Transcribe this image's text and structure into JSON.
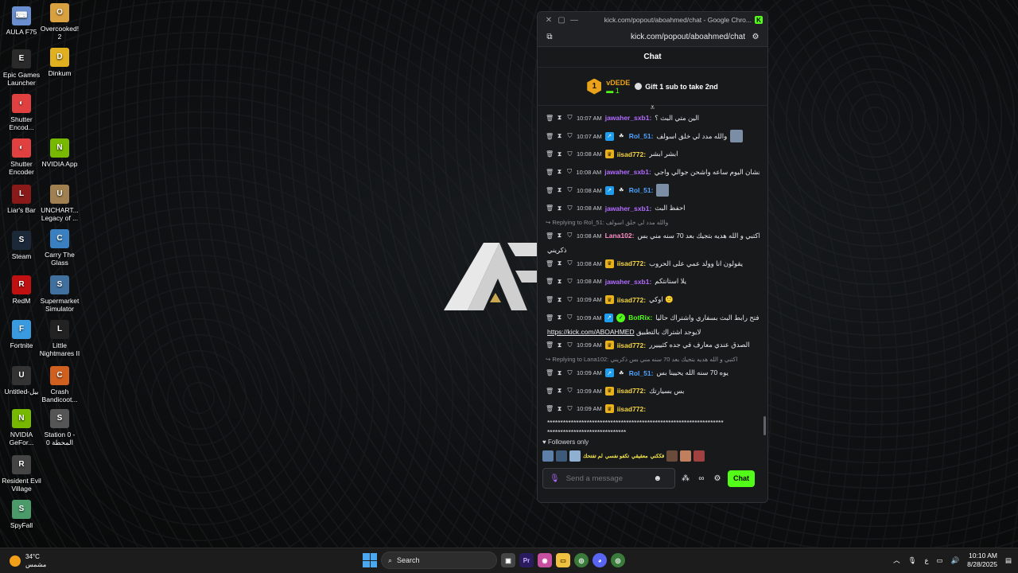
{
  "desktop": {
    "icons": [
      {
        "label": "AULA F75",
        "color": "#6a8fd0",
        "glyph": "⌨"
      },
      {
        "label": "Overcooked! 2",
        "color": "#d9a040",
        "glyph": "O"
      },
      {
        "label": "Epic Games Launcher",
        "color": "#2a2a2a",
        "glyph": "E"
      },
      {
        "label": "Dinkum",
        "color": "#e0b020",
        "glyph": "D"
      },
      {
        "label": "Shutter Encod...",
        "color": "#e04040",
        "glyph": "◐"
      },
      {
        "label": "Shutter Encoder",
        "color": "#e04040",
        "glyph": "◐"
      },
      {
        "label": "NVIDIA App",
        "color": "#76b900",
        "glyph": "N"
      },
      {
        "label": "Liar's Bar",
        "color": "#8a1a1a",
        "glyph": "L"
      },
      {
        "label": "UNCHART... Legacy of ...",
        "color": "#a08050",
        "glyph": "U"
      },
      {
        "label": "Steam",
        "color": "#1b2838",
        "glyph": "S"
      },
      {
        "label": "Carry The Glass",
        "color": "#3a80c0",
        "glyph": "C"
      },
      {
        "label": "RedM",
        "color": "#c01010",
        "glyph": "R"
      },
      {
        "label": "Supermarket Simulator",
        "color": "#4070a0",
        "glyph": "S"
      },
      {
        "label": "Fortnite",
        "color": "#3a9ae0",
        "glyph": "F"
      },
      {
        "label": "Little Nightmares II",
        "color": "#222",
        "glyph": "L"
      },
      {
        "label": "Untitled-بيل",
        "color": "#333",
        "glyph": "U"
      },
      {
        "label": "Crash Bandicoot...",
        "color": "#d06020",
        "glyph": "C"
      },
      {
        "label": "NVIDIA GeFor...",
        "color": "#76b900",
        "glyph": "N"
      },
      {
        "label": "Station 0 - المحطة 0",
        "color": "#555",
        "glyph": "S"
      },
      {
        "label": "Resident Evil Village",
        "color": "#444",
        "glyph": "R"
      },
      {
        "label": "SpyFall",
        "color": "#4a9a6a",
        "glyph": "S"
      }
    ]
  },
  "window": {
    "title": "kick.com/popout/aboahmed/chat - Google Chro...",
    "url": "kick.com/popout/aboahmed/chat"
  },
  "chat": {
    "header": "Chat",
    "pinned": {
      "rank": "1",
      "gifter": "vDEDE",
      "count": "1",
      "gift_text": "Gift 1 sub to take 2nd"
    },
    "messages": [
      {
        "time": "10:07 AM",
        "user": "jawaher_sxb1:",
        "color": "#b36bff",
        "badges": [],
        "text": "الين متي البث ؟"
      },
      {
        "time": "10:07 AM",
        "user": "Rol_51:",
        "color": "#4fa3ff",
        "badges": [
          "og",
          "sub"
        ],
        "text": "والله مدد لي خلق اسولف",
        "avatar": true
      },
      {
        "time": "10:08 AM",
        "user": "iisad772:",
        "color": "#f5d742",
        "badges": [
          "crown"
        ],
        "text": "ابشر ابشر"
      },
      {
        "time": "10:08 AM",
        "user": "jawaher_sxb1:",
        "color": "#b36bff",
        "badges": [],
        "text": "عشان اليوم ساعه واشحن جوالي واجي"
      },
      {
        "time": "10:08 AM",
        "user": "Rol_51:",
        "color": "#4fa3ff",
        "badges": [
          "og",
          "sub"
        ],
        "text": "",
        "avatar": true
      },
      {
        "time": "10:08 AM",
        "user": "jawaher_sxb1:",
        "color": "#b36bff",
        "badges": [],
        "text": "احفظ البث"
      },
      {
        "reply": "Replying to Rol_51: والله مدد لي خلق اسولف"
      },
      {
        "time": "10:08 AM",
        "user": "Lana102:",
        "color": "#ff8fc8",
        "badges": [],
        "text": "اكتبي و الله هديه بتجيك بعد 70 سنه مني بس",
        "wrap": "ذكريني"
      },
      {
        "time": "10:08 AM",
        "user": "iisad772:",
        "color": "#f5d742",
        "badges": [
          "crown"
        ],
        "text": "يقولون انا وولد عمي على الحروب"
      },
      {
        "time": "10:08 AM",
        "user": "jawaher_sxb1:",
        "color": "#b36bff",
        "badges": [],
        "text": "يلا استانتكم"
      },
      {
        "time": "10:09 AM",
        "user": "iisad772:",
        "color": "#f5d742",
        "badges": [
          "crown"
        ],
        "text": "اوكي 🙂"
      },
      {
        "time": "10:09 AM",
        "user": "BotRix:",
        "color": "#53fc18",
        "badges": [
          "og",
          "verified"
        ],
        "text": "افتح رابط البث بسفاري واشتراك حاليا",
        "link": "https://kick.com/ABOAHMED",
        "wrap": "لايوجد اشتراك بالتطبيق"
      },
      {
        "time": "10:09 AM",
        "user": "iisad772:",
        "color": "#f5d742",
        "badges": [
          "crown"
        ],
        "text": "الصدق عندي معارف في جده كثيييرر"
      },
      {
        "reply": "Replying to Lana102: اكتبي و الله هديه بتجيك بعد 70 سنه مني بس ذكريني"
      },
      {
        "time": "10:09 AM",
        "user": "Rol_51:",
        "color": "#4fa3ff",
        "badges": [
          "og",
          "sub"
        ],
        "text": "يوه 70 سنه الله يحيينا بس"
      },
      {
        "time": "10:09 AM",
        "user": "iisad772:",
        "color": "#f5d742",
        "badges": [
          "crown"
        ],
        "text": "بس بسيارتك"
      },
      {
        "time": "10:09 AM",
        "user": "iisad772:",
        "color": "#f5d742",
        "badges": [
          "crown"
        ],
        "text": "",
        "wrap": "*******************************************************************",
        "wrap2": "******************************"
      }
    ],
    "followers_only": "Followers only",
    "emote_texts": [
      "لم تفتحك",
      "تكفو نفسي",
      "معقيقي",
      "فككني"
    ],
    "input_placeholder": "Send a message",
    "send_label": "Chat"
  },
  "taskbar": {
    "temperature": "34°C",
    "weather_text": "مشمس",
    "search_label": "Search",
    "language": "ع",
    "time": "10:10 AM",
    "date": "8/28/2025"
  }
}
